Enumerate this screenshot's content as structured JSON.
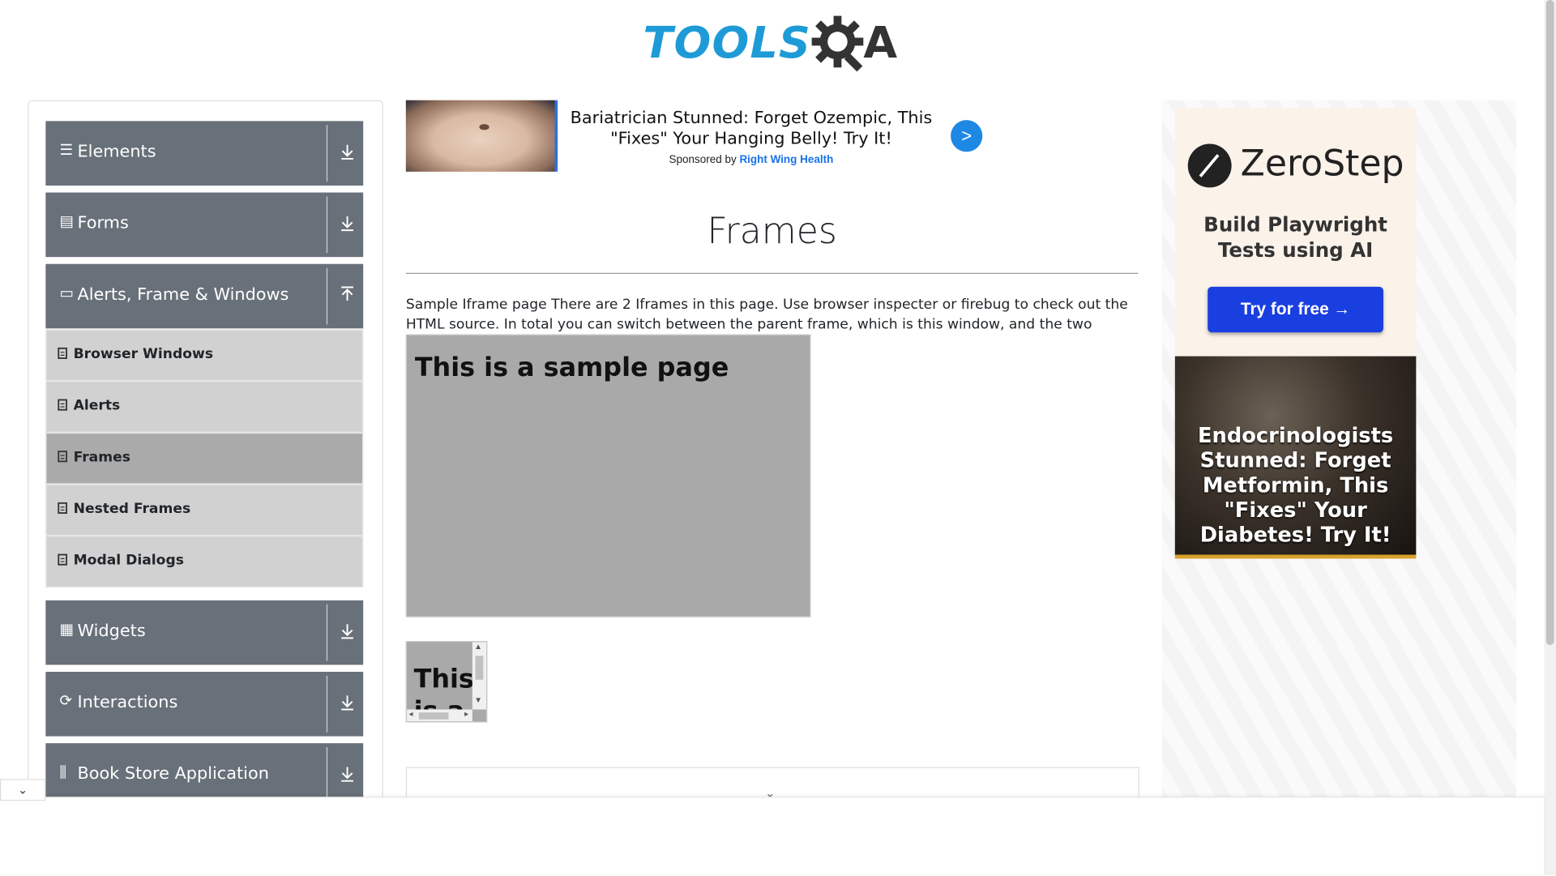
{
  "header": {
    "logo_left": "TOOLS",
    "logo_right": "A"
  },
  "sidebar": {
    "groups": [
      {
        "label": "Elements",
        "icon": "hamburger-icon"
      },
      {
        "label": "Forms",
        "icon": "document-icon"
      },
      {
        "label": "Alerts, Frame & Windows",
        "icon": "window-icon"
      },
      {
        "label": "Widgets",
        "icon": "grid-icon"
      },
      {
        "label": "Interactions",
        "icon": "interaction-icon"
      },
      {
        "label": "Book Store Application",
        "icon": "books-icon"
      }
    ],
    "items": [
      {
        "label": "Browser Windows"
      },
      {
        "label": "Alerts"
      },
      {
        "label": "Frames"
      },
      {
        "label": "Nested Frames"
      },
      {
        "label": "Modal Dialogs"
      }
    ]
  },
  "ad_top": {
    "headline": "Bariatrician Stunned: Forget Ozempic, This \"Fixes\" Your Hanging Belly! Try It!",
    "sponsored_prefix": "Sponsored by",
    "sponsor": "Right Wing Health",
    "button": ">"
  },
  "main": {
    "title": "Frames",
    "description": "Sample Iframe page There are 2 Iframes in this page. Use browser inspecter or firebug to check out the HTML source. In total you can switch between the parent frame, which is this window, and the two frames below",
    "frame1_heading": "This is a sample page",
    "frame2_heading": "This is a"
  },
  "ad_right": {
    "brand": "ZeroStep",
    "tagline": "Build Playwright Tests using AI",
    "cta": "Try for free →",
    "promo": "Endocrinologists Stunned: Forget Metformin, This \"Fixes\" Your Diabetes! Try It!"
  }
}
